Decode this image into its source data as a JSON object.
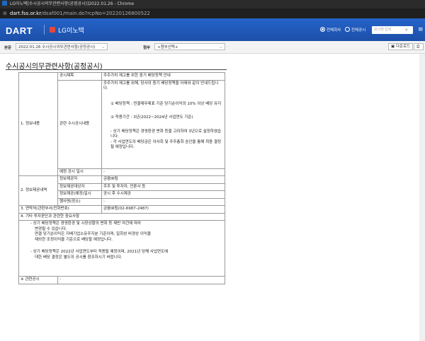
{
  "browser": {
    "window_title": "LG이노텍[수시공시의무관련사항(공정공시)]2022.01.26 - Chrome",
    "url_host": "dart.fss.or.kr",
    "url_path": "/dsaf001/main.do?rcpNo=20220126800522"
  },
  "header": {
    "logo": "DART",
    "company_name": "LG이노텍",
    "radio_all": "전체회사",
    "radio_company": "전체공시",
    "search_placeholder": "회사명 입력"
  },
  "toolbar": {
    "main_label": "본문",
    "main_select": "2022.01.26   수시공시의무관련사항(공정공시)",
    "attach_label": "첨부",
    "attach_select": "+첨부선택+",
    "download_button": "다운로드",
    "print_button": "인쇄"
  },
  "document": {
    "title": "수시공시의무관련사항(공정공시)",
    "section1": "1. 정보내용",
    "subject_label": "공시제목",
    "subject_value": "주주가치 제고를 위한 중기 배당정책 안내",
    "content_label": "관련 수시공시내용",
    "content_intro": "주주가치 제고를 위해, 당사의 중기 배당정책을 아래와 같이 안내드립니다.",
    "content_item1": "① 배당정책 : 연결재무제표 기준 당기순이익의 10% 이상 배당 유지",
    "content_item2": "② 적용기간 : 3년(2022~2024년 사업연도 기준)",
    "content_note1": "- 상기 배당정책은 경영환경 변화 등을 고려하여 3년으로 설정하였습니다.",
    "content_note2": "- 각 사업연도의 배당금은 이사회 및 주주총회 승인을 통해 최종 결정될 예정입니다.",
    "planned_date_label": "예정 공시 일시",
    "planned_date_value": "-",
    "section2": "2. 정보제공내역",
    "provider_label": "정보제공자",
    "provider_value": "금융IR팀",
    "recipient_label": "정보제공대상자",
    "recipient_value": "주주 및 투자자, 언론사 등",
    "when_label": "정보제공(예정)일시",
    "when_value": "공시 후 수시제공",
    "place_label": "행사명(장소)",
    "place_value": "-",
    "section3_label": "3. 연락처(관련부서/전화번호)",
    "section3_value": "금융IR팀(02-6987-2487)",
    "section4_label": "4. 기타 투자판단과 관련한 중요사항",
    "notes_line1": "- 상기 배당정책은 경영환경 및 시장상황의 변화 등 제반 여건에 따라",
    "notes_line2": "변경될 수 있습니다.",
    "notes_line3": "연결 당기순이익은 지배기업소유주지분 기준이며, 일회성 비경상 이익을",
    "notes_line4": "제외한 조정이익을 기준으로 배당할 예정입니다.",
    "notes_line5": "- 상기 배당정책은 2022년 사업연도부터 적용될 예정이며, 2021년 당해 사업연도에",
    "notes_line6": "대한 배당 결정은 별도의 공시를 참조하시기 바랍니다.",
    "related_label": "※ 관련공시",
    "related_value": "-"
  },
  "colors": {
    "header_blue": "#2563c9",
    "company_icon": "#e8473b"
  }
}
